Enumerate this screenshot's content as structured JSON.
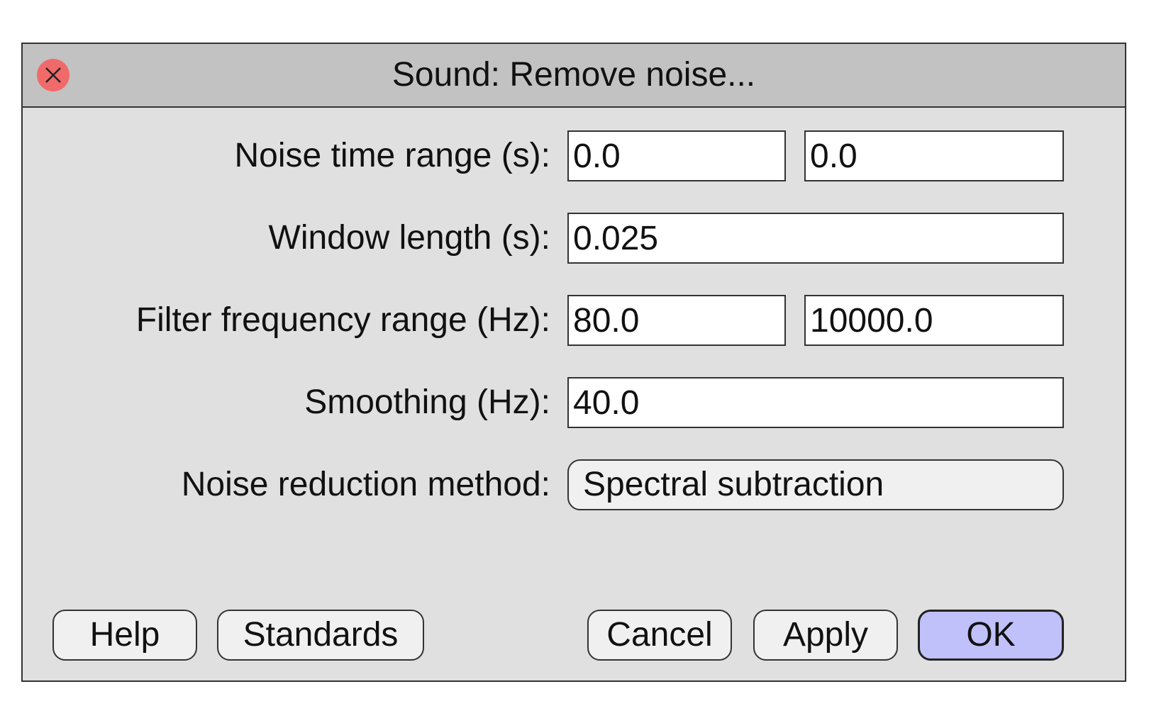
{
  "dialog": {
    "title": "Sound: Remove noise...",
    "close_icon": "close-x-icon",
    "close_color": "#f06a6a",
    "titlebar_color": "#c2c2c2",
    "background_color": "#e0e0e0"
  },
  "fields": {
    "noise_time_range": {
      "label": "Noise time range (s):",
      "from": "0.0",
      "to": "0.0"
    },
    "window_length": {
      "label": "Window length (s):",
      "value": "0.025"
    },
    "filter_frequency_range": {
      "label": "Filter frequency range (Hz):",
      "from": "80.0",
      "to": "10000.0"
    },
    "smoothing": {
      "label": "Smoothing (Hz):",
      "value": "40.0"
    },
    "noise_reduction_method": {
      "label": "Noise reduction method:",
      "selected": "Spectral subtraction"
    }
  },
  "buttons": {
    "help": "Help",
    "standards": "Standards",
    "cancel": "Cancel",
    "apply": "Apply",
    "ok": "OK",
    "ok_color": "#c0c0fa"
  }
}
